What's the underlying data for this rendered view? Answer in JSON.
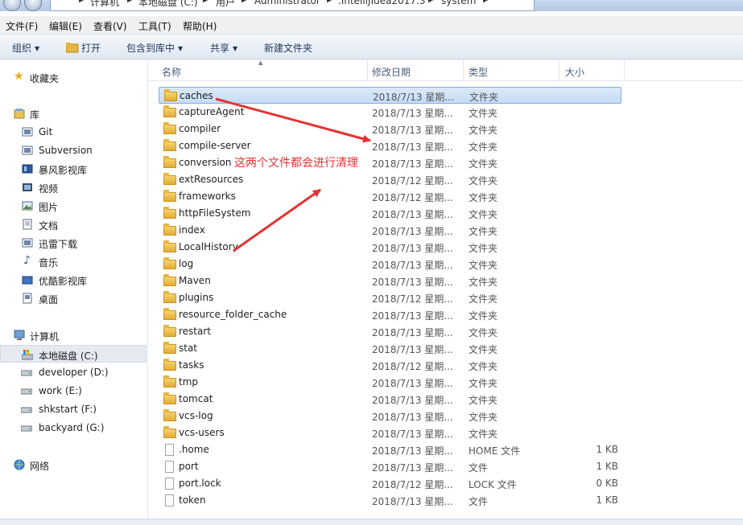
{
  "address": {
    "crumbs": [
      "计算机",
      "本地磁盘 (C:)",
      "用户",
      "Administrator",
      ".IntelliJIdea2017.3",
      "system"
    ]
  },
  "menu": [
    "文件(F)",
    "编辑(E)",
    "查看(V)",
    "工具(T)",
    "帮助(H)"
  ],
  "toolbar": {
    "organize": "组织",
    "open": "打开",
    "include_library": "包含到库中",
    "share": "共享",
    "new_folder": "新建文件夹"
  },
  "sidebar": {
    "favorites": "收藏夹",
    "library": "库",
    "library_items": [
      "Git",
      "Subversion",
      "暴风影视库",
      "视频",
      "图片",
      "文档",
      "迅雷下载",
      "音乐",
      "优酷影视库",
      "桌面"
    ],
    "computer": "计算机",
    "drives": [
      "本地磁盘 (C:)",
      "developer (D:)",
      "work (E:)",
      "shkstart (F:)",
      "backyard (G:)"
    ],
    "network": "网络"
  },
  "columns": {
    "name": "名称",
    "date": "修改日期",
    "type": "类型",
    "size": "大小"
  },
  "files": [
    {
      "name": "caches",
      "date": "2018/7/13 星期...",
      "type": "文件夹",
      "size": "",
      "kind": "folder"
    },
    {
      "name": "captureAgent",
      "date": "2018/7/13 星期...",
      "type": "文件夹",
      "size": "",
      "kind": "folder"
    },
    {
      "name": "compiler",
      "date": "2018/7/13 星期...",
      "type": "文件夹",
      "size": "",
      "kind": "folder"
    },
    {
      "name": "compile-server",
      "date": "2018/7/13 星期...",
      "type": "文件夹",
      "size": "",
      "kind": "folder"
    },
    {
      "name": "conversion",
      "date": "2018/7/13 星期...",
      "type": "文件夹",
      "size": "",
      "kind": "folder"
    },
    {
      "name": "extResources",
      "date": "2018/7/12 星期...",
      "type": "文件夹",
      "size": "",
      "kind": "folder"
    },
    {
      "name": "frameworks",
      "date": "2018/7/12 星期...",
      "type": "文件夹",
      "size": "",
      "kind": "folder"
    },
    {
      "name": "httpFileSystem",
      "date": "2018/7/13 星期...",
      "type": "文件夹",
      "size": "",
      "kind": "folder"
    },
    {
      "name": "index",
      "date": "2018/7/13 星期...",
      "type": "文件夹",
      "size": "",
      "kind": "folder"
    },
    {
      "name": "LocalHistory",
      "date": "2018/7/13 星期...",
      "type": "文件夹",
      "size": "",
      "kind": "folder"
    },
    {
      "name": "log",
      "date": "2018/7/13 星期...",
      "type": "文件夹",
      "size": "",
      "kind": "folder"
    },
    {
      "name": "Maven",
      "date": "2018/7/13 星期...",
      "type": "文件夹",
      "size": "",
      "kind": "folder"
    },
    {
      "name": "plugins",
      "date": "2018/7/12 星期...",
      "type": "文件夹",
      "size": "",
      "kind": "folder"
    },
    {
      "name": "resource_folder_cache",
      "date": "2018/7/13 星期...",
      "type": "文件夹",
      "size": "",
      "kind": "folder"
    },
    {
      "name": "restart",
      "date": "2018/7/13 星期...",
      "type": "文件夹",
      "size": "",
      "kind": "folder"
    },
    {
      "name": "stat",
      "date": "2018/7/13 星期...",
      "type": "文件夹",
      "size": "",
      "kind": "folder"
    },
    {
      "name": "tasks",
      "date": "2018/7/12 星期...",
      "type": "文件夹",
      "size": "",
      "kind": "folder"
    },
    {
      "name": "tmp",
      "date": "2018/7/13 星期...",
      "type": "文件夹",
      "size": "",
      "kind": "folder"
    },
    {
      "name": "tomcat",
      "date": "2018/7/13 星期...",
      "type": "文件夹",
      "size": "",
      "kind": "folder"
    },
    {
      "name": "vcs-log",
      "date": "2018/7/13 星期...",
      "type": "文件夹",
      "size": "",
      "kind": "folder"
    },
    {
      "name": "vcs-users",
      "date": "2018/7/13 星期...",
      "type": "文件夹",
      "size": "",
      "kind": "folder"
    },
    {
      "name": ".home",
      "date": "2018/7/13 星期...",
      "type": "HOME 文件",
      "size": "1 KB",
      "kind": "file"
    },
    {
      "name": "port",
      "date": "2018/7/13 星期...",
      "type": "文件",
      "size": "1 KB",
      "kind": "file"
    },
    {
      "name": "port.lock",
      "date": "2018/7/12 星期...",
      "type": "LOCK 文件",
      "size": "0 KB",
      "kind": "file"
    },
    {
      "name": "token",
      "date": "2018/7/13 星期...",
      "type": "文件",
      "size": "1 KB",
      "kind": "file"
    }
  ],
  "annotation": "这两个文件都会进行清理",
  "colors": {
    "annotation": "#e53333",
    "selection": "#c4dcf5",
    "folder": "#e0a82e"
  }
}
